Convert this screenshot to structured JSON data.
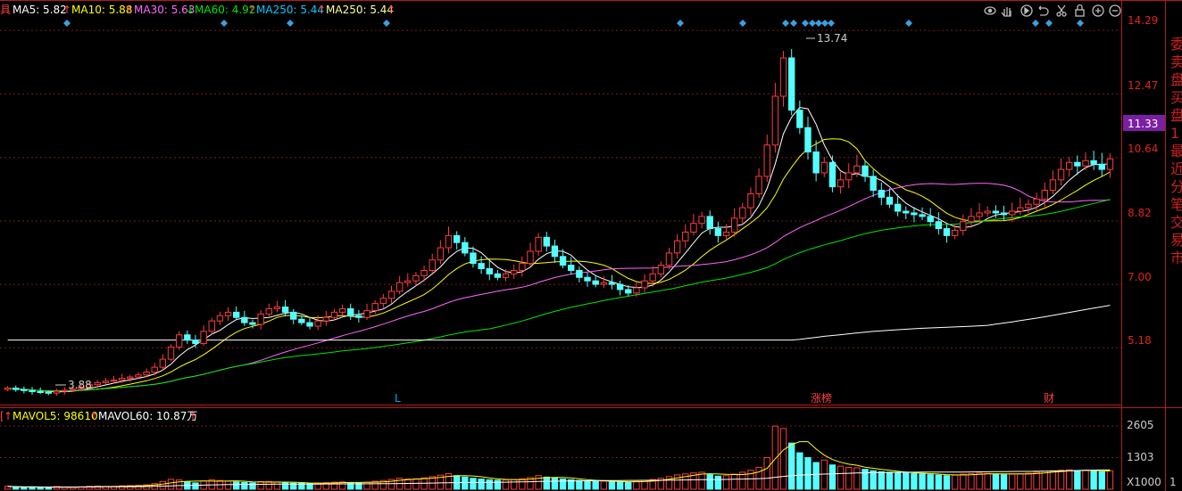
{
  "top_legend": {
    "prefix": "具",
    "ma5": {
      "label": "MA5: 5.82",
      "arrow": "↑",
      "color": "#ffffff"
    },
    "ma10": {
      "label": "MA10: 5.88",
      "arrow": "↑",
      "color": "#ffff00"
    },
    "ma30": {
      "label": "MA30: 5.63",
      "arrow": "↓",
      "color": "#ff66ff"
    },
    "ma60": {
      "label": "MA60: 4.92",
      "arrow": "↑",
      "color": "#00e600"
    },
    "ma250a": {
      "label": "MA250: 5.44",
      "arrow": "↑",
      "color": "#00ccff"
    },
    "ma250b": {
      "label": "MA250: 5.44",
      "arrow": "↑",
      "color": "#ffff99"
    }
  },
  "vol_legend": {
    "prefix": "[",
    "prefix_arrow": "↑",
    "mavol5": "MAVOL5: 98610",
    "mavol5_arrow": "↑",
    "mavol60": "MAVOL60: 10.87万",
    "mavol60_arrow": "↑"
  },
  "toolbar_icons": [
    "eye-icon",
    "hand-icon",
    "play-icon",
    "refresh-icon",
    "scissors-icon",
    "lock-icon",
    "zoom-in-icon",
    "zoom-out-icon"
  ],
  "price_axis": {
    "ticks": [
      "14.29",
      "12.47",
      "10.64",
      "8.82",
      "7.00",
      "5.18"
    ],
    "current_price": "11.33",
    "current_price_color": "#7a1fa2"
  },
  "volume_axis": {
    "ticks": [
      "2605",
      "1303"
    ],
    "unit": "X1000",
    "unit_prefix": "1"
  },
  "markers": {
    "high_label": "13.74",
    "low_label": "3.88",
    "bottom_labels": [
      {
        "text": "L",
        "color": "#00aaff"
      },
      {
        "text": "涨榜",
        "color": "#ff4040"
      },
      {
        "text": "财",
        "color": "#ff4040"
      }
    ]
  },
  "side_panel": {
    "chars": [
      "委",
      "卖",
      "盘",
      "买",
      "盘",
      "1",
      "最",
      "近",
      "分",
      "笔",
      "交",
      "易",
      "市"
    ]
  },
  "chart_data": {
    "type": "candlestick",
    "ylim": [
      3.6,
      14.6
    ],
    "ma5_last": 5.82,
    "ma10_last": 5.88,
    "ma30_last": 5.63,
    "ma60_last": 4.92,
    "ma250_last": 5.44,
    "high": 13.74,
    "low": 3.88,
    "last": 10.6,
    "mavol5": 98610,
    "volume_ylim": [
      0,
      2605
    ],
    "close_series": [
      4.02,
      3.98,
      3.95,
      3.92,
      3.9,
      3.88,
      3.93,
      3.96,
      3.99,
      4.05,
      4.12,
      4.18,
      4.22,
      4.25,
      4.3,
      4.34,
      4.4,
      4.48,
      4.62,
      4.85,
      5.2,
      5.55,
      5.4,
      5.3,
      5.65,
      5.95,
      6.1,
      6.2,
      6.05,
      5.9,
      5.85,
      6.15,
      6.3,
      6.35,
      6.2,
      6.0,
      5.9,
      5.8,
      5.95,
      6.05,
      6.2,
      6.3,
      6.1,
      6.05,
      6.25,
      6.45,
      6.6,
      6.8,
      7.05,
      7.1,
      7.25,
      7.4,
      7.7,
      8.05,
      8.4,
      8.2,
      7.9,
      7.6,
      7.45,
      7.3,
      7.2,
      7.3,
      7.4,
      7.6,
      7.95,
      8.35,
      8.1,
      7.8,
      7.55,
      7.4,
      7.2,
      7.1,
      7.0,
      7.05,
      7.0,
      6.85,
      6.75,
      6.9,
      7.1,
      7.3,
      7.55,
      7.9,
      8.25,
      8.5,
      8.75,
      8.95,
      8.6,
      8.4,
      8.5,
      8.9,
      9.2,
      9.6,
      10.1,
      11.0,
      12.4,
      13.5,
      12.0,
      11.5,
      10.8,
      10.2,
      10.5,
      9.8,
      10.0,
      10.2,
      10.4,
      10.1,
      9.7,
      9.5,
      9.3,
      9.1,
      9.05,
      9.0,
      8.95,
      8.8,
      8.6,
      8.4,
      8.55,
      8.8,
      8.95,
      9.05,
      9.1,
      9.05,
      9.0,
      9.1,
      9.2,
      9.3,
      9.45,
      9.7,
      10.0,
      10.3,
      10.5,
      10.4,
      10.55,
      10.45,
      10.3,
      10.6
    ],
    "volume_series": [
      120,
      90,
      80,
      95,
      70,
      65,
      110,
      90,
      85,
      100,
      120,
      130,
      115,
      105,
      140,
      150,
      160,
      180,
      230,
      320,
      410,
      380,
      300,
      260,
      340,
      390,
      360,
      330,
      300,
      280,
      260,
      310,
      320,
      300,
      270,
      250,
      240,
      230,
      260,
      270,
      290,
      300,
      270,
      260,
      290,
      330,
      360,
      400,
      450,
      420,
      430,
      470,
      520,
      580,
      640,
      560,
      500,
      450,
      420,
      390,
      370,
      380,
      400,
      430,
      480,
      560,
      500,
      460,
      420,
      390,
      360,
      340,
      320,
      330,
      310,
      300,
      290,
      320,
      360,
      400,
      450,
      520,
      590,
      630,
      670,
      700,
      600,
      540,
      560,
      620,
      700,
      780,
      900,
      1300,
      2600,
      2500,
      1900,
      1500,
      1300,
      1100,
      1200,
      1000,
      950,
      900,
      880,
      820,
      760,
      720,
      700,
      680,
      660,
      640,
      630,
      600,
      580,
      560,
      580,
      620,
      640,
      660,
      650,
      620,
      600,
      620,
      640,
      660,
      700,
      740,
      760,
      780,
      800,
      760,
      780,
      740,
      720,
      760
    ]
  }
}
